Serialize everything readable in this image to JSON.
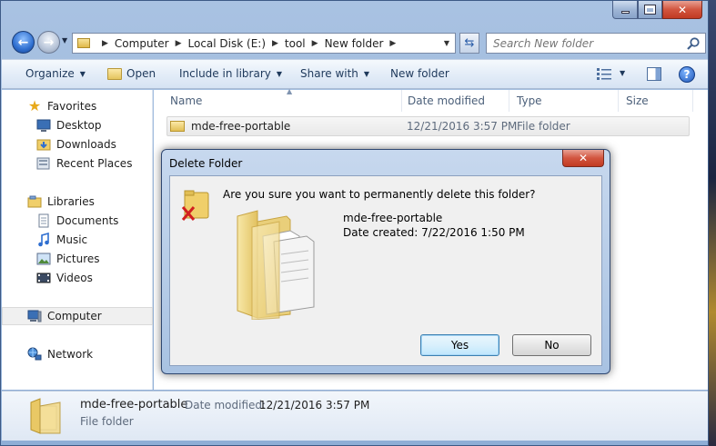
{
  "window": {
    "title": ""
  },
  "navigation": {
    "breadcrumb": [
      "Computer",
      "Local Disk (E:)",
      "tool",
      "New folder"
    ],
    "search_placeholder": "Search New folder"
  },
  "toolbar": {
    "organize_label": "Organize",
    "open_label": "Open",
    "include_label": "Include in library",
    "share_label": "Share with",
    "new_folder_label": "New folder"
  },
  "sidebar": {
    "favorites_label": "Favorites",
    "desktop_label": "Desktop",
    "downloads_label": "Downloads",
    "recent_label": "Recent Places",
    "libraries_label": "Libraries",
    "documents_label": "Documents",
    "music_label": "Music",
    "pictures_label": "Pictures",
    "videos_label": "Videos",
    "computer_label": "Computer",
    "network_label": "Network"
  },
  "columns": {
    "name": "Name",
    "date_modified": "Date modified",
    "type": "Type",
    "size": "Size"
  },
  "files": [
    {
      "name": "mde-free-portable",
      "date_modified": "12/21/2016 3:57 PM",
      "type": "File folder",
      "size": ""
    }
  ],
  "details": {
    "name": "mde-free-portable",
    "date_label": "Date modified:",
    "date_value": "12/21/2016 3:57 PM",
    "type": "File folder"
  },
  "dialog": {
    "title": "Delete Folder",
    "question": "Are you sure you want to permanently delete this folder?",
    "folder_name": "mde-free-portable",
    "date_created": "Date created: 7/22/2016 1:50 PM",
    "yes_label": "Yes",
    "no_label": "No"
  },
  "colors": {
    "title_frame": "#a9c2e2",
    "close_red": "#c13a22",
    "toolbar_text": "#1e395b",
    "default_button_border": "#3c7fb1"
  }
}
